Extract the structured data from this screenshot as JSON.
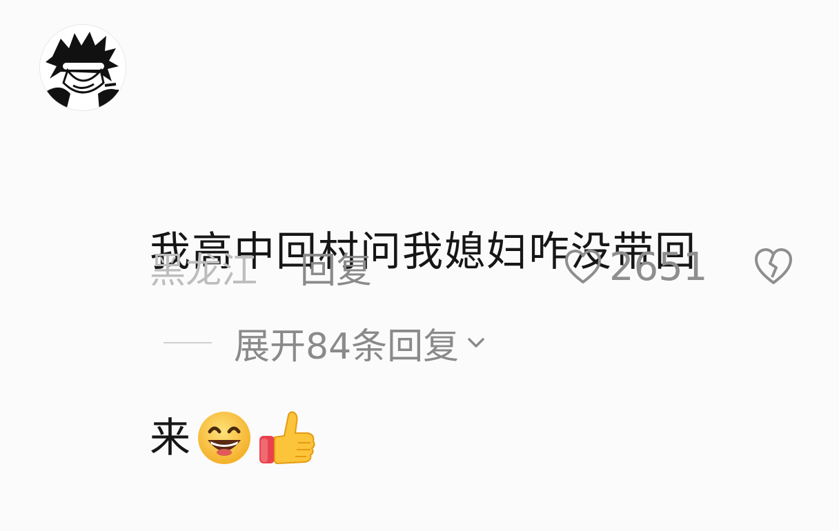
{
  "comment": {
    "line1": "我高中回村问我媳妇咋没带回",
    "line2": "来",
    "emojis": [
      "grinning-face-emoji",
      "thumbs-up-emoji"
    ]
  },
  "meta": {
    "location": "黑龙江",
    "reply_label": "回复",
    "like_count": "2651"
  },
  "expand": {
    "label": "展开84条回复"
  },
  "icons": {
    "like": "heart-outline-icon",
    "dislike": "broken-heart-icon",
    "expand": "chevron-down-icon"
  },
  "colors": {
    "background": "#fbfbfb",
    "text": "#161616",
    "muted": "#8a8a8a",
    "location": "#bdbdbd"
  }
}
